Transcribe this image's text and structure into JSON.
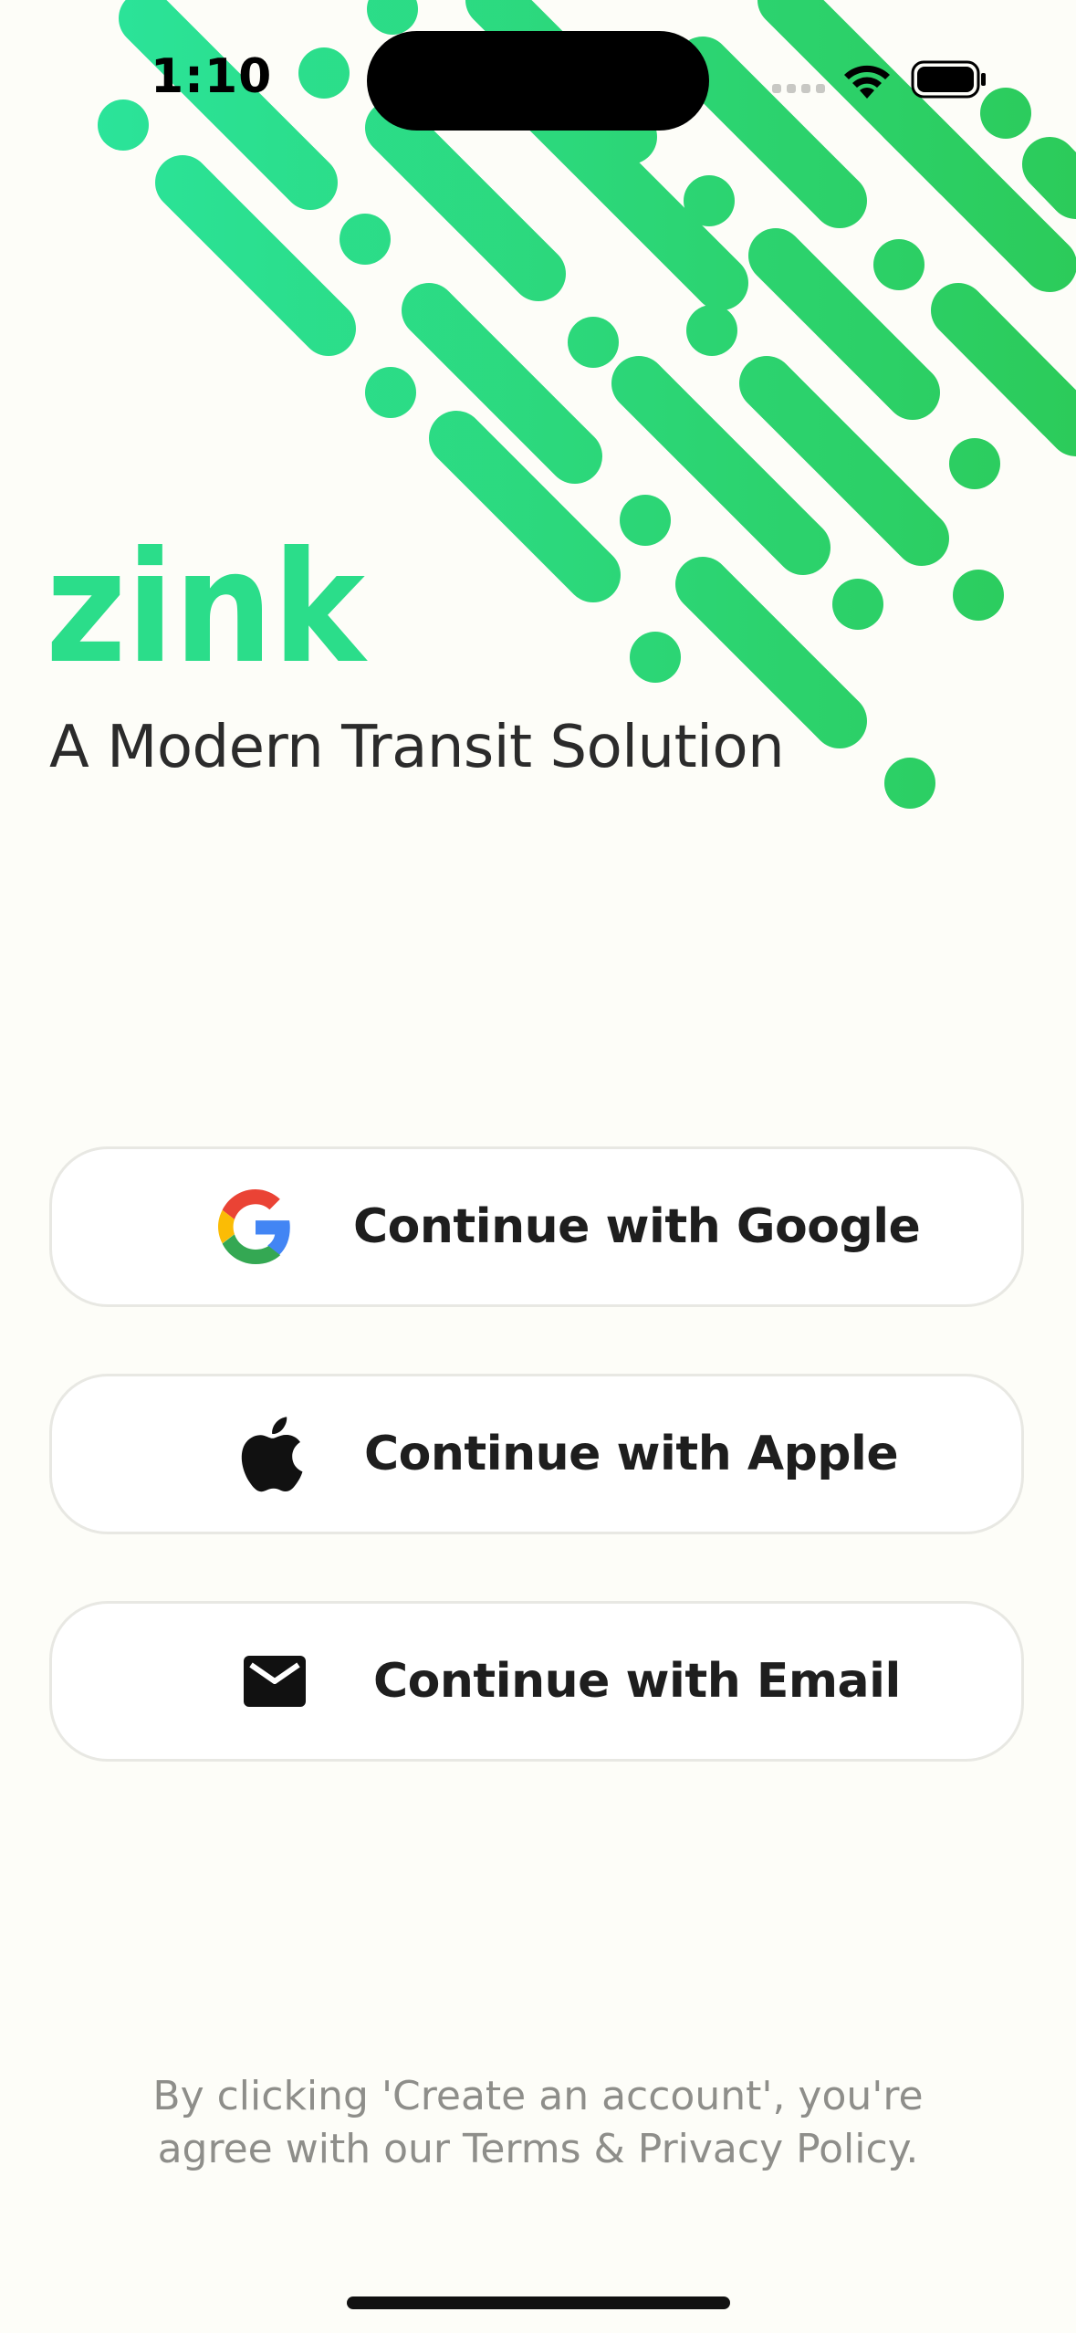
{
  "status_bar": {
    "time": "1:10",
    "icons": [
      "cellular-signal-icon",
      "wifi-icon",
      "battery-icon"
    ]
  },
  "brand": {
    "logo_text": "zink",
    "tagline": "A Modern Transit Solution",
    "accent_color": "#2BDD8A",
    "accent_color_dark": "#2CCB5A"
  },
  "auth": {
    "google_label": "Continue with Google",
    "apple_label": "Continue with Apple",
    "email_label": "Continue with Email",
    "google_icon": "google-icon",
    "apple_icon": "apple-icon",
    "email_icon": "mail-icon"
  },
  "legal": {
    "line1": "By clicking 'Create an account', you're",
    "line2": "agree with our Terms & Privacy Policy."
  }
}
